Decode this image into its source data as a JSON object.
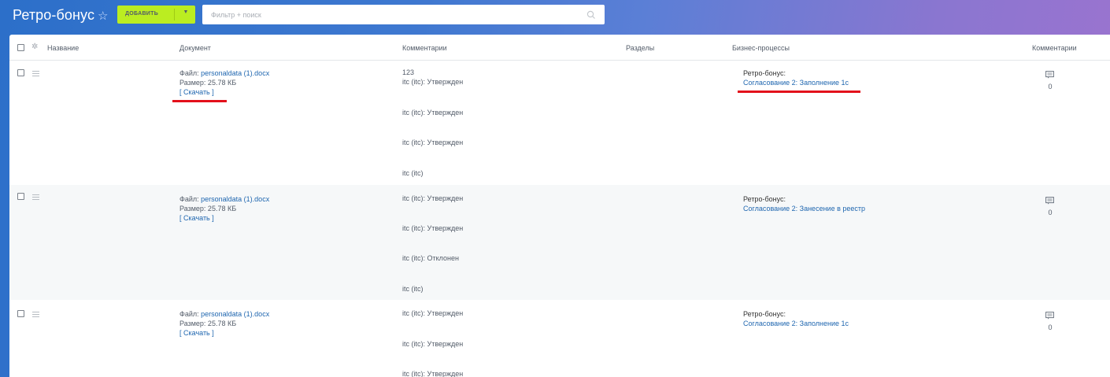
{
  "header": {
    "title": "Ретро-бонус",
    "add_button": "ДОБАВИТЬ",
    "search_placeholder": "Фильтр + поиск"
  },
  "columns": {
    "name": "Название",
    "document": "Документ",
    "comments": "Комментарии",
    "sections": "Разделы",
    "business_processes": "Бизнес-процессы",
    "comments_count": "Комментарии"
  },
  "rows": [
    {
      "file_prefix": "Файл: ",
      "file_name": "personaldata (1).docx",
      "size": "Размер: 25.78 КБ",
      "download": "[ Скачать ]",
      "comments": [
        "123",
        "itc (itc): Утвержден",
        "itc (itc): Утвержден",
        "itc (itc): Утвержден",
        "itc (itc)"
      ],
      "bp_title": "Ретро-бонус:",
      "bp_link": "Согласование 2: Заполнение 1с",
      "comment_count": "0"
    },
    {
      "file_prefix": "Файл: ",
      "file_name": "personaldata (1).docx",
      "size": "Размер: 25.78 КБ",
      "download": "[ Скачать ]",
      "comments": [
        "itc (itc): Утвержден",
        "itc (itc): Утвержден",
        "itc (itc): Отклонен",
        "itc (itc)"
      ],
      "bp_title": "Ретро-бонус:",
      "bp_link": "Согласование 2: Занесение в реестр",
      "comment_count": "0"
    },
    {
      "file_prefix": "Файл: ",
      "file_name": "personaldata (1).docx",
      "size": "Размер: 25.78 КБ",
      "download": "[ Скачать ]",
      "comments": [
        "itc (itc): Утвержден",
        "itc (itc): Утвержден",
        "itc (itc): Утвержден"
      ],
      "bp_title": "Ретро-бонус:",
      "bp_link": "Согласование 2: Заполнение 1с",
      "comment_count": "0"
    }
  ],
  "colors": {
    "accent_green": "#bbed21",
    "link_blue": "#2067b0",
    "highlight_red": "#e3101b"
  }
}
